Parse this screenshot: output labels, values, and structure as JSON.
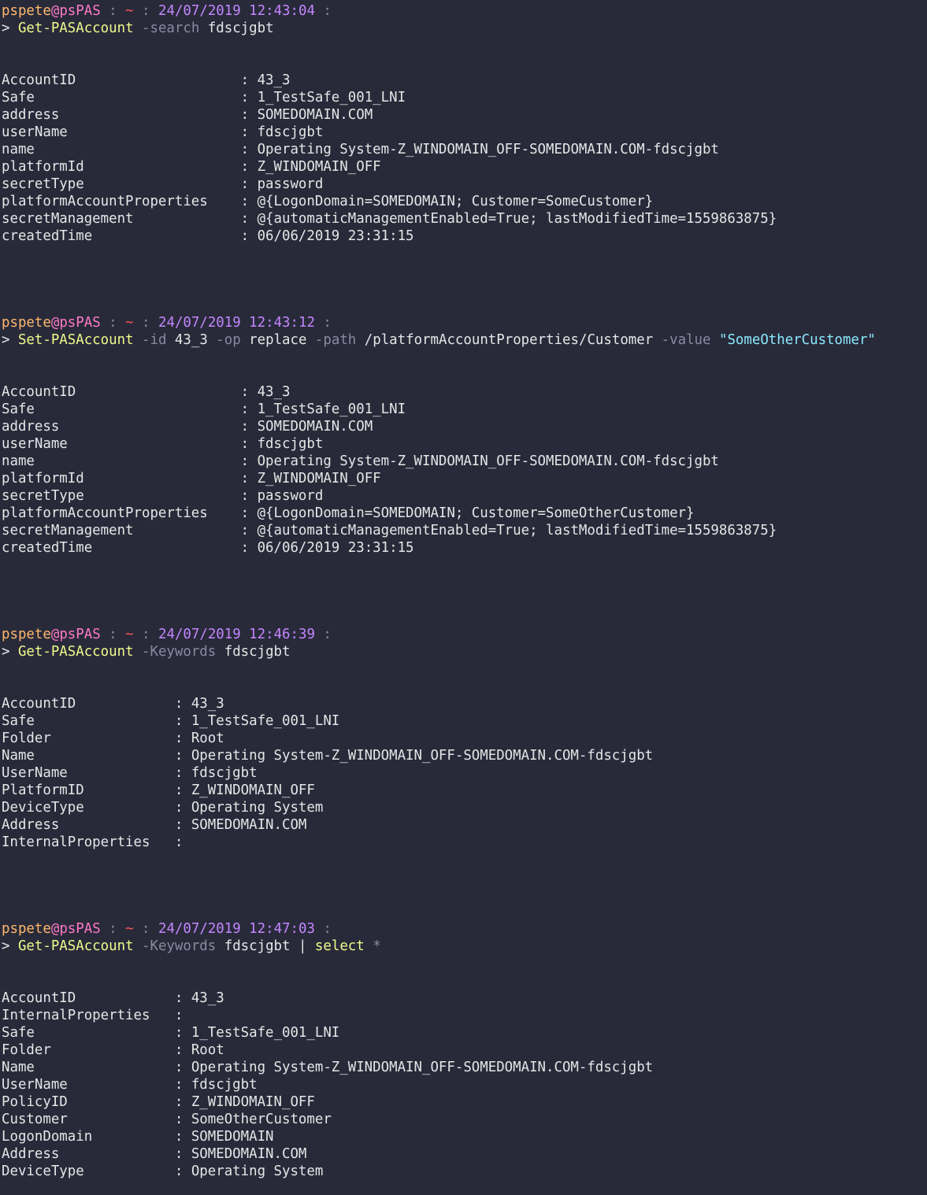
{
  "colors": {
    "background": "#282a3a",
    "user": "#ffb86c",
    "host": "#ff79c6",
    "tilde": "#ff5555",
    "timestamp": "#c586ff",
    "cmdlet": "#f1fa8c",
    "parameter": "#8a8aa0",
    "string": "#8be9fd",
    "text": "#e6e6e6"
  },
  "blocks": [
    {
      "prompt": {
        "user": "pspete",
        "at": "@",
        "host": "psPAS",
        "sep1": " : ",
        "tilde": "~",
        "sep2": " : ",
        "timestamp": "24/07/2019 12:43:04",
        "sep3": " :"
      },
      "command": {
        "prefix": "> ",
        "cmdlet": "Get-PASAccount",
        "tokens": [
          {
            "type": "param",
            "text": " -search"
          },
          {
            "type": "arg",
            "text": " fdscjgbt"
          }
        ]
      },
      "key_width": 29,
      "output": [
        {
          "key": "AccountID",
          "value": "43_3"
        },
        {
          "key": "Safe",
          "value": "1_TestSafe_001_LNI"
        },
        {
          "key": "address",
          "value": "SOMEDOMAIN.COM"
        },
        {
          "key": "userName",
          "value": "fdscjgbt"
        },
        {
          "key": "name",
          "value": "Operating System-Z_WINDOMAIN_OFF-SOMEDOMAIN.COM-fdscjgbt"
        },
        {
          "key": "platformId",
          "value": "Z_WINDOMAIN_OFF"
        },
        {
          "key": "secretType",
          "value": "password"
        },
        {
          "key": "platformAccountProperties",
          "value": "@{LogonDomain=SOMEDOMAIN; Customer=SomeCustomer}"
        },
        {
          "key": "secretManagement",
          "value": "@{automaticManagementEnabled=True; lastModifiedTime=1559863875}"
        },
        {
          "key": "createdTime",
          "value": "06/06/2019 23:31:15"
        }
      ]
    },
    {
      "prompt": {
        "user": "pspete",
        "at": "@",
        "host": "psPAS",
        "sep1": " : ",
        "tilde": "~",
        "sep2": " : ",
        "timestamp": "24/07/2019 12:43:12",
        "sep3": " :"
      },
      "command": {
        "prefix": "> ",
        "cmdlet": "Set-PASAccount",
        "tokens": [
          {
            "type": "param",
            "text": " -id"
          },
          {
            "type": "arg",
            "text": " 43_3"
          },
          {
            "type": "param",
            "text": " -op"
          },
          {
            "type": "arg",
            "text": " replace"
          },
          {
            "type": "param",
            "text": " -path"
          },
          {
            "type": "arg",
            "text": " /platformAccountProperties/Customer"
          },
          {
            "type": "param",
            "text": " -value"
          },
          {
            "type": "str",
            "text": " \"SomeOtherCustomer\""
          }
        ]
      },
      "key_width": 29,
      "output": [
        {
          "key": "AccountID",
          "value": "43_3"
        },
        {
          "key": "Safe",
          "value": "1_TestSafe_001_LNI"
        },
        {
          "key": "address",
          "value": "SOMEDOMAIN.COM"
        },
        {
          "key": "userName",
          "value": "fdscjgbt"
        },
        {
          "key": "name",
          "value": "Operating System-Z_WINDOMAIN_OFF-SOMEDOMAIN.COM-fdscjgbt"
        },
        {
          "key": "platformId",
          "value": "Z_WINDOMAIN_OFF"
        },
        {
          "key": "secretType",
          "value": "password"
        },
        {
          "key": "platformAccountProperties",
          "value": "@{LogonDomain=SOMEDOMAIN; Customer=SomeOtherCustomer}"
        },
        {
          "key": "secretManagement",
          "value": "@{automaticManagementEnabled=True; lastModifiedTime=1559863875}"
        },
        {
          "key": "createdTime",
          "value": "06/06/2019 23:31:15"
        }
      ]
    },
    {
      "prompt": {
        "user": "pspete",
        "at": "@",
        "host": "psPAS",
        "sep1": " : ",
        "tilde": "~",
        "sep2": " : ",
        "timestamp": "24/07/2019 12:46:39",
        "sep3": " :"
      },
      "command": {
        "prefix": "> ",
        "cmdlet": "Get-PASAccount",
        "tokens": [
          {
            "type": "param",
            "text": " -Keywords"
          },
          {
            "type": "arg",
            "text": " fdscjgbt"
          }
        ]
      },
      "key_width": 21,
      "output": [
        {
          "key": "AccountID",
          "value": "43_3"
        },
        {
          "key": "Safe",
          "value": "1_TestSafe_001_LNI"
        },
        {
          "key": "Folder",
          "value": "Root"
        },
        {
          "key": "Name",
          "value": "Operating System-Z_WINDOMAIN_OFF-SOMEDOMAIN.COM-fdscjgbt"
        },
        {
          "key": "UserName",
          "value": "fdscjgbt"
        },
        {
          "key": "PlatformID",
          "value": "Z_WINDOMAIN_OFF"
        },
        {
          "key": "DeviceType",
          "value": "Operating System"
        },
        {
          "key": "Address",
          "value": "SOMEDOMAIN.COM"
        },
        {
          "key": "InternalProperties",
          "value": ""
        }
      ]
    },
    {
      "prompt": {
        "user": "pspete",
        "at": "@",
        "host": "psPAS",
        "sep1": " : ",
        "tilde": "~",
        "sep2": " : ",
        "timestamp": "24/07/2019 12:47:03",
        "sep3": " :"
      },
      "command": {
        "prefix": "> ",
        "cmdlet": "Get-PASAccount",
        "tokens": [
          {
            "type": "param",
            "text": " -Keywords"
          },
          {
            "type": "arg",
            "text": " fdscjgbt"
          },
          {
            "type": "pipe",
            "text": " |"
          },
          {
            "type": "cmdlet",
            "text": " select"
          },
          {
            "type": "param",
            "text": " *"
          }
        ]
      },
      "key_width": 21,
      "output": [
        {
          "key": "AccountID",
          "value": "43_3"
        },
        {
          "key": "InternalProperties",
          "value": ""
        },
        {
          "key": "Safe",
          "value": "1_TestSafe_001_LNI"
        },
        {
          "key": "Folder",
          "value": "Root"
        },
        {
          "key": "Name",
          "value": "Operating System-Z_WINDOMAIN_OFF-SOMEDOMAIN.COM-fdscjgbt"
        },
        {
          "key": "UserName",
          "value": "fdscjgbt"
        },
        {
          "key": "PolicyID",
          "value": "Z_WINDOMAIN_OFF"
        },
        {
          "key": "Customer",
          "value": "SomeOtherCustomer"
        },
        {
          "key": "LogonDomain",
          "value": "SOMEDOMAIN"
        },
        {
          "key": "Address",
          "value": "SOMEDOMAIN.COM"
        },
        {
          "key": "DeviceType",
          "value": "Operating System"
        }
      ]
    }
  ]
}
